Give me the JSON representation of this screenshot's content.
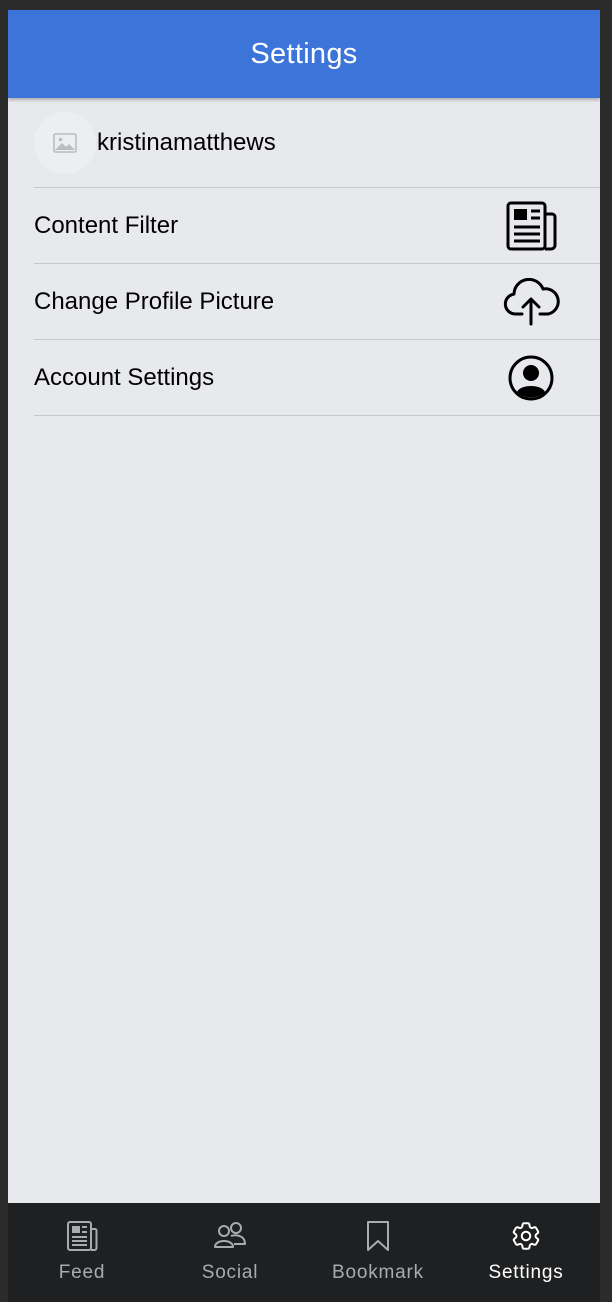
{
  "header": {
    "title": "Settings"
  },
  "profile": {
    "username": "kristinamatthews"
  },
  "options": [
    {
      "label": "Content Filter",
      "icon": "newspaper-icon"
    },
    {
      "label": "Change Profile Picture",
      "icon": "cloud-upload-icon"
    },
    {
      "label": "Account Settings",
      "icon": "user-circle-icon"
    }
  ],
  "tabs": [
    {
      "label": "Feed",
      "icon": "newspaper-icon",
      "active": false
    },
    {
      "label": "Social",
      "icon": "people-icon",
      "active": false
    },
    {
      "label": "Bookmark",
      "icon": "bookmark-icon",
      "active": false
    },
    {
      "label": "Settings",
      "icon": "gear-icon",
      "active": true
    }
  ],
  "colors": {
    "header": "#3d74d9",
    "background": "#e8e9ec",
    "tabbar": "#1f2021",
    "tab_inactive": "#a9abae",
    "tab_active": "#ffffff"
  }
}
